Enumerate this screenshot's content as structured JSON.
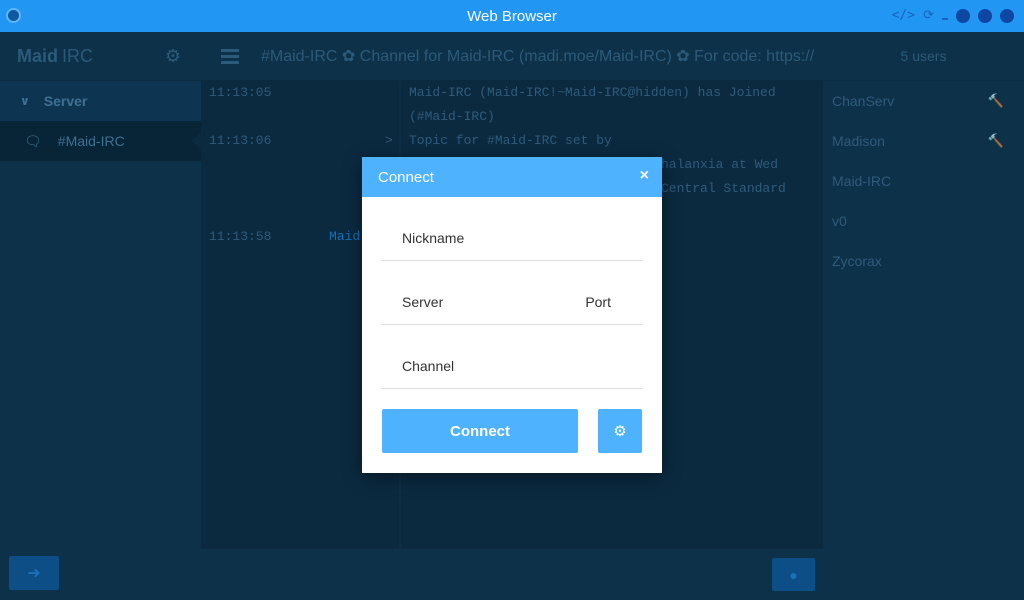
{
  "window": {
    "title": "Web Browser"
  },
  "sidebar": {
    "brand_bold": "Maid",
    "brand_light": "IRC",
    "server_label": "Server",
    "channel_label": "#Maid-IRC"
  },
  "topic": "#Maid-IRC ✿ Channel for Maid-IRC (madi.moe/Maid-IRC) ✿ For code: https://",
  "messages": {
    "t1": "11:13:05",
    "t2": "11:13:06",
    "t2_marker": ">",
    "t3": "11:13:58",
    "t3_nick": "Maid",
    "m1_line1": "Maid-IRC (Maid-IRC!~Maid-IRC@hidden) has Joined",
    "m1_line2": "(#Maid-IRC)",
    "m2_line1": "Topic for #Maid-IRC set by",
    "m2_line2": "halanxia at Wed",
    "m2_line3": "Central Standard"
  },
  "users": {
    "count_label": "5 users",
    "list": [
      "ChanServ",
      "Madison",
      "Maid-IRC",
      "v0",
      "Zycorax"
    ]
  },
  "modal": {
    "title": "Connect",
    "close": "×",
    "nickname_label": "Nickname",
    "server_label": "Server",
    "port_label": "Port",
    "channel_label": "Channel",
    "connect_label": "Connect"
  },
  "icons": {
    "gear": "gear-icon",
    "chat": "chat-bubbles-icon",
    "login": "sign-in-icon",
    "send": "comment-icon",
    "op": "gavel-icon"
  }
}
